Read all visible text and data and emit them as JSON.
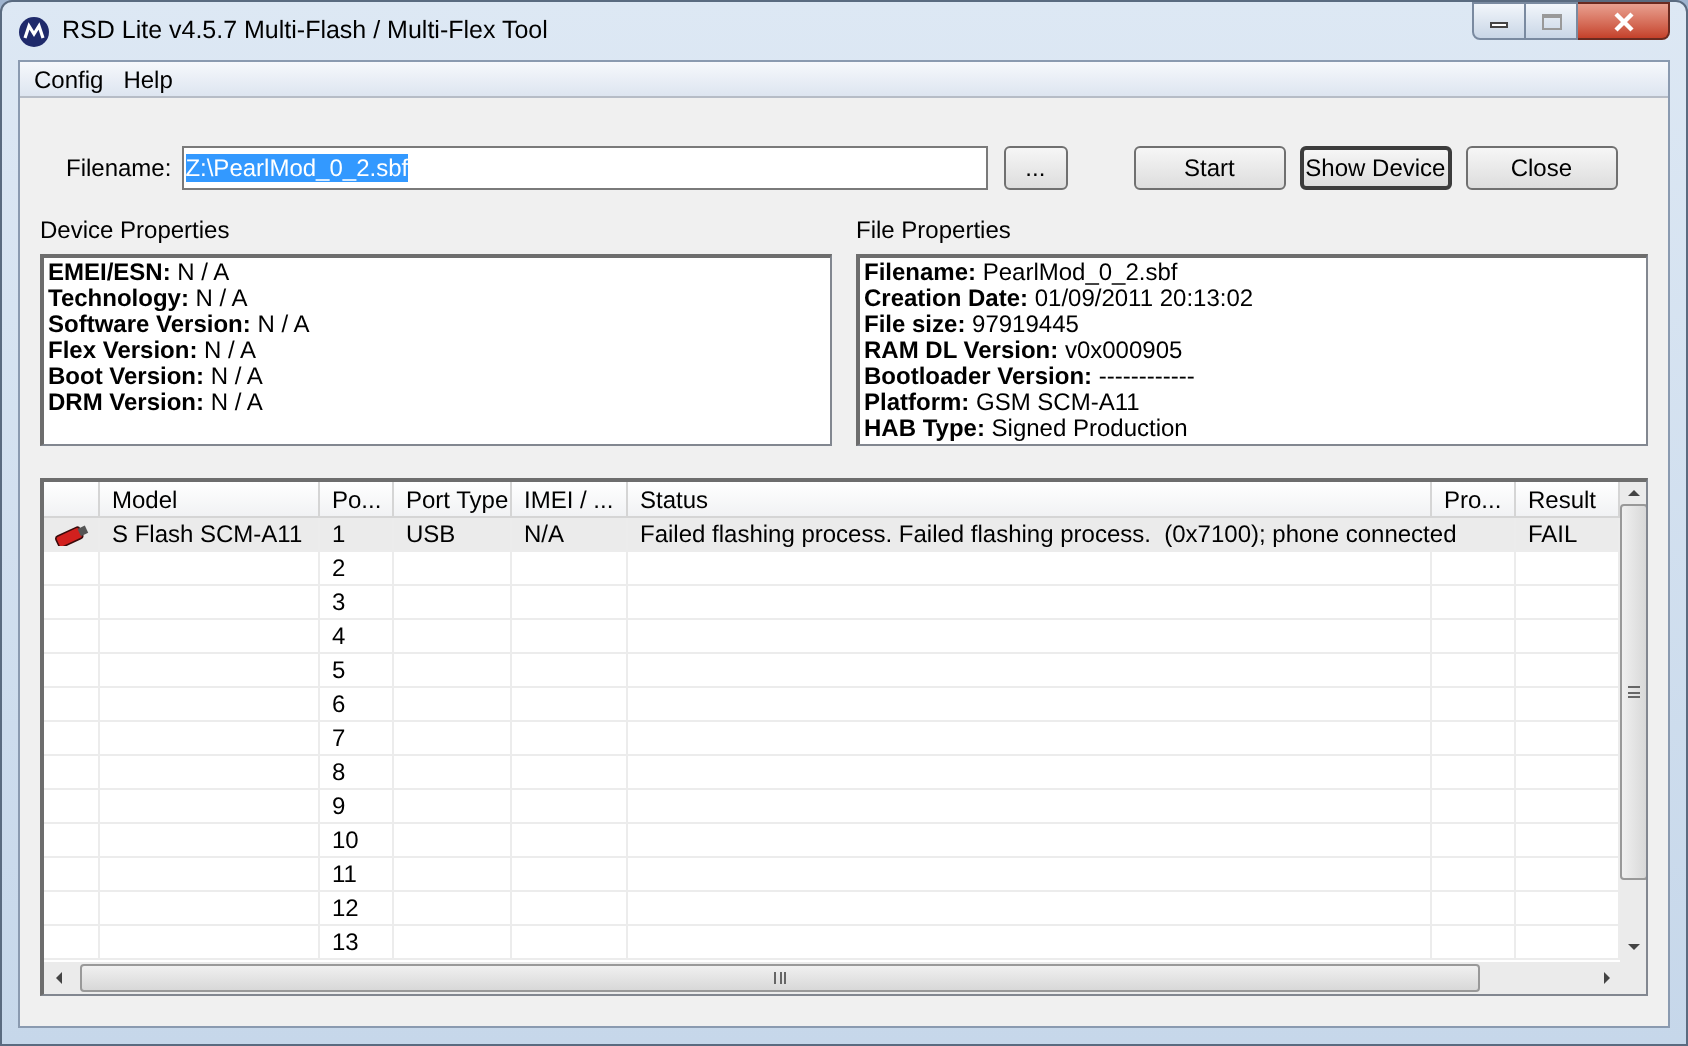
{
  "window": {
    "title": "RSD Lite v4.5.7 Multi-Flash / Multi-Flex Tool"
  },
  "menu": [
    "Config",
    "Help"
  ],
  "filename": {
    "label": "Filename:",
    "value": "Z:\\PearlMod_0_2.sbf",
    "selected": true
  },
  "buttons": [
    {
      "label": "...",
      "kind": "browse"
    },
    {
      "label": "Start",
      "kind": "action"
    },
    {
      "label": "Show Device",
      "kind": "default"
    },
    {
      "label": "Close",
      "kind": "action"
    }
  ],
  "device_properties": {
    "title": "Device Properties",
    "lines": [
      "**EMEI/ESN:** N / A",
      "**Technology:** N / A",
      "**Software Version:** N / A",
      "**Flex Version:** N / A",
      "**Boot Version:** N / A",
      "**DRM Version:** N / A"
    ]
  },
  "file_properties": {
    "title": "File Properties",
    "lines": [
      "**Filename:** PearlMod_0_2.sbf",
      "**Creation Date:** 01/09/2011 20:13:02",
      "**File size:** 97919445",
      "**RAM DL Version:** v0x000905",
      "**Bootloader Version:** ------------",
      "**Platform:** GSM SCM-A11",
      "**HAB Type:** Signed Production"
    ]
  },
  "table": {
    "columns": [
      "Model",
      "Po...",
      "Port Type",
      "IMEI / ...",
      "Status",
      "Pro...",
      "Result"
    ],
    "rows": [
      {
        "selected": true,
        "device": true,
        "cells": [
          "S Flash SCM-A11",
          "1",
          "USB",
          "N/A",
          "Failed flashing process. Failed flashing process.  (0x7100); phone connected",
          "",
          "FAIL"
        ]
      },
      {
        "selected": false,
        "device": false,
        "cells": [
          "",
          "2",
          "",
          "",
          "",
          "",
          ""
        ]
      },
      {
        "selected": false,
        "device": false,
        "cells": [
          "",
          "3",
          "",
          "",
          "",
          "",
          ""
        ]
      },
      {
        "selected": false,
        "device": false,
        "cells": [
          "",
          "4",
          "",
          "",
          "",
          "",
          ""
        ]
      },
      {
        "selected": false,
        "device": false,
        "cells": [
          "",
          "5",
          "",
          "",
          "",
          "",
          ""
        ]
      },
      {
        "selected": false,
        "device": false,
        "cells": [
          "",
          "6",
          "",
          "",
          "",
          "",
          ""
        ]
      },
      {
        "selected": false,
        "device": false,
        "cells": [
          "",
          "7",
          "",
          "",
          "",
          "",
          ""
        ]
      },
      {
        "selected": false,
        "device": false,
        "cells": [
          "",
          "8",
          "",
          "",
          "",
          "",
          ""
        ]
      },
      {
        "selected": false,
        "device": false,
        "cells": [
          "",
          "9",
          "",
          "",
          "",
          "",
          ""
        ]
      },
      {
        "selected": false,
        "device": false,
        "cells": [
          "",
          "10",
          "",
          "",
          "",
          "",
          ""
        ]
      },
      {
        "selected": false,
        "device": false,
        "cells": [
          "",
          "11",
          "",
          "",
          "",
          "",
          ""
        ]
      },
      {
        "selected": false,
        "device": false,
        "cells": [
          "",
          "12",
          "",
          "",
          "",
          "",
          ""
        ]
      },
      {
        "selected": false,
        "device": false,
        "cells": [
          "",
          "13",
          "",
          "",
          "",
          "",
          ""
        ]
      }
    ]
  }
}
